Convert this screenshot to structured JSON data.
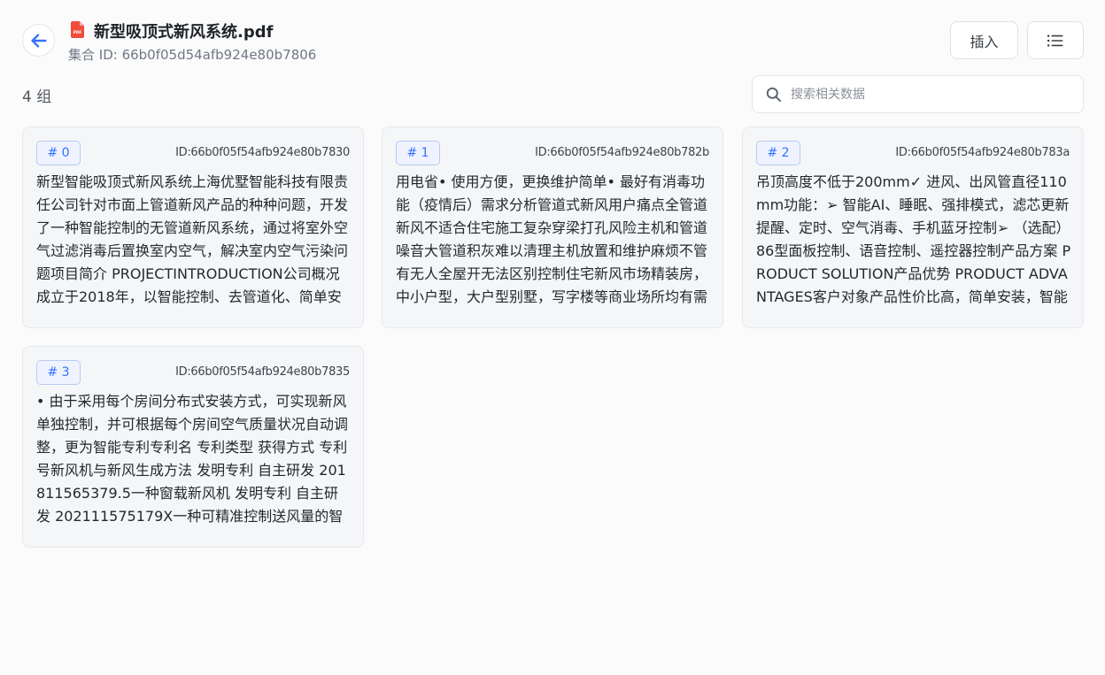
{
  "header": {
    "file_title": "新型吸顶式新风系统.pdf",
    "collection_id": "集合 ID: 66b0f05d54afb924e80b7806",
    "insert_label": "插入",
    "pdf_icon_label": "PDF"
  },
  "toolbar": {
    "group_count": "4 组",
    "search_placeholder": "搜索相关数据"
  },
  "cards": [
    {
      "index": "# 0",
      "id": "ID:66b0f05f54afb924e80b7830",
      "content": "新型智能吸顶式新风系统上海优墅智能科技有限责任公司针对市面上管道新风产品的种种问题，开发了一种智能控制的无管道新风系统，通过将室外空气过滤消毒后置换室内空气，解决室内空气污染问题项目简介 PROJECTINTRODUCTION公司概况成立于2018年，以智能控制、去管道化、简单安装、易维护为方向"
    },
    {
      "index": "# 1",
      "id": "ID:66b0f05f54afb924e80b782b",
      "content": "用电省• 使用方便，更换维护简单• 最好有消毒功能（疫情后）需求分析管道式新风用户痛点全管道新风不适合住宅施工复杂穿梁打孔风险主机和管道噪音大管道积灰难以清理主机放置和维护麻烦不管有无人全屋开无法区别控制住宅新风市场精装房，中小户型，大户型别墅，写字楼等商业场所均有需求"
    },
    {
      "index": "# 2",
      "id": "ID:66b0f05f54afb924e80b783a",
      "content": "吊顶高度不低于200mm✓ 进风、出风管直径110mm功能：➢ 智能AI、睡眠、强排模式，滤芯更新提醒、定时、空气消毒、手机蓝牙控制➢ （选配）86型面板控制、语音控制、遥控器控制产品方案 PRODUCT SOLUTION产品优势 PRODUCT ADVANTAGES客户对象产品性价比高，简单安装，智能控制，适合住宅及商业场所"
    },
    {
      "index": "# 3",
      "id": "ID:66b0f05f54afb924e80b7835",
      "content": "• 由于采用每个房间分布式安装方式，可实现新风单独控制，并可根据每个房间空气质量状况自动调整，更为智能专利专利名 专利类型 获得方式 专利号新风机与新风生成方法 发明专利 自主研发 201811565379.5一种窗载新风机 发明专利 自主研发 202111575179X一种可精准控制送风量的智能新风系统"
    }
  ]
}
